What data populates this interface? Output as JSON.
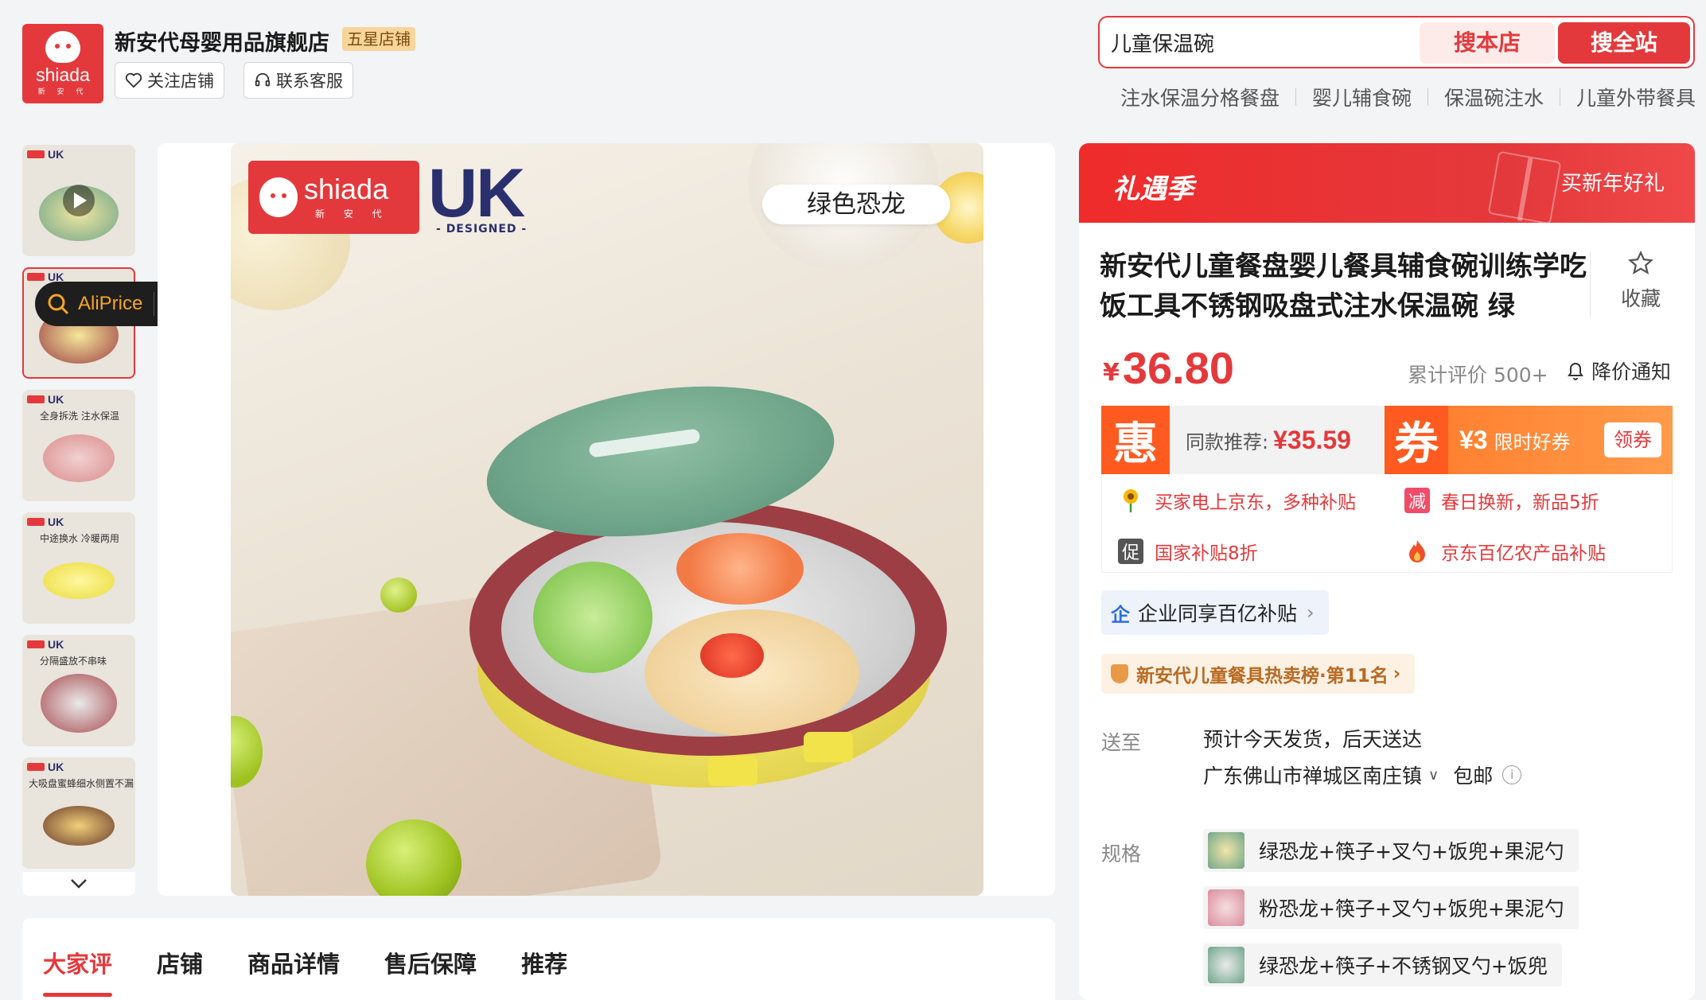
{
  "store": {
    "logo_text": "shiada",
    "logo_sub": "新 安 代",
    "name": "新安代母婴用品旗舰店",
    "badge": "五星店铺",
    "follow_label": "关注店铺",
    "contact_label": "联系客服"
  },
  "search": {
    "query": "儿童保温碗",
    "local_label": "搜本店",
    "all_label": "搜全站",
    "hot_words": [
      "注水保温分格餐盘",
      "婴儿辅食碗",
      "保温碗注水",
      "儿童外带餐具"
    ]
  },
  "thumbnails": [
    {
      "tag": "UK",
      "caption": "",
      "video": true
    },
    {
      "tag": "UK",
      "caption": "",
      "video": false
    },
    {
      "tag": "UK",
      "caption": "全身拆洗 注水保温",
      "video": false
    },
    {
      "tag": "UK",
      "caption": "中途换水 冷暖两用",
      "video": false
    },
    {
      "tag": "UK",
      "caption": "分隔盛放不串味",
      "video": false
    },
    {
      "tag": "UK",
      "caption": "大吸盘蜜蜂细水侧置不漏",
      "video": false
    }
  ],
  "aliprice": {
    "label": "AliPrice"
  },
  "main_image": {
    "brand_word": "shiada",
    "brand_sub": "新 安 代",
    "uk_mark": "UK",
    "designed": "DESIGNED",
    "color_name": "绿色恐龙"
  },
  "tabs": [
    {
      "label": "大家评",
      "active": true
    },
    {
      "label": "店铺",
      "active": false
    },
    {
      "label": "商品详情",
      "active": false
    },
    {
      "label": "售后保障",
      "active": false
    },
    {
      "label": "推荐",
      "active": false
    }
  ],
  "promo": {
    "title": "礼遇季",
    "right_text": "买新年好礼"
  },
  "product": {
    "title": "新安代儿童餐盘婴儿餐具辅食碗训练学吃饭工具不锈钢吸盘式注水保温碗 绿",
    "favorite_label": "收藏",
    "currency": "¥",
    "price": "36.80",
    "review_count": "累计评价 500+",
    "price_alert": "降价通知"
  },
  "deal": {
    "hui_icon": "惠",
    "similar_text": "同款推荐:",
    "similar_price": "¥35.59",
    "quan_icon": "券",
    "coupon_amount": "¥3",
    "coupon_text": "限时好券",
    "coupon_button": "领券"
  },
  "benefits": [
    {
      "icon": "sunflower-icon",
      "text": "买家电上京东，多种补贴"
    },
    {
      "icon": "jian-badge-icon",
      "badge": "减",
      "text": "春日换新，新品5折"
    },
    {
      "icon": "cu-badge-icon",
      "badge": "促",
      "text": "国家补贴8折"
    },
    {
      "icon": "flame-icon",
      "text": "京东百亿农产品补贴"
    }
  ],
  "enterprise": {
    "icon": "企",
    "label": "企业同享百亿补贴"
  },
  "rank": {
    "label": "新安代儿童餐具热卖榜·第11名"
  },
  "shipping": {
    "label": "送至",
    "eta": "预计今天发货，后天送达",
    "address": "广东佛山市禅城区南庄镇",
    "free_shipping": "包邮"
  },
  "specs": {
    "label": "规格",
    "options": [
      "绿恐龙+筷子+叉勺+饭兜+果泥勺",
      "粉恐龙+筷子+叉勺+饭兜+果泥勺",
      "绿恐龙+筷子+不锈钢叉勺+饭兜"
    ]
  },
  "colors": {
    "accent": "#e4393c",
    "orange": "#ff5a1f",
    "dino_green": "#6fa58a",
    "bowl_yellow": "#e9dc5a",
    "rim_red": "#9c3e44"
  }
}
